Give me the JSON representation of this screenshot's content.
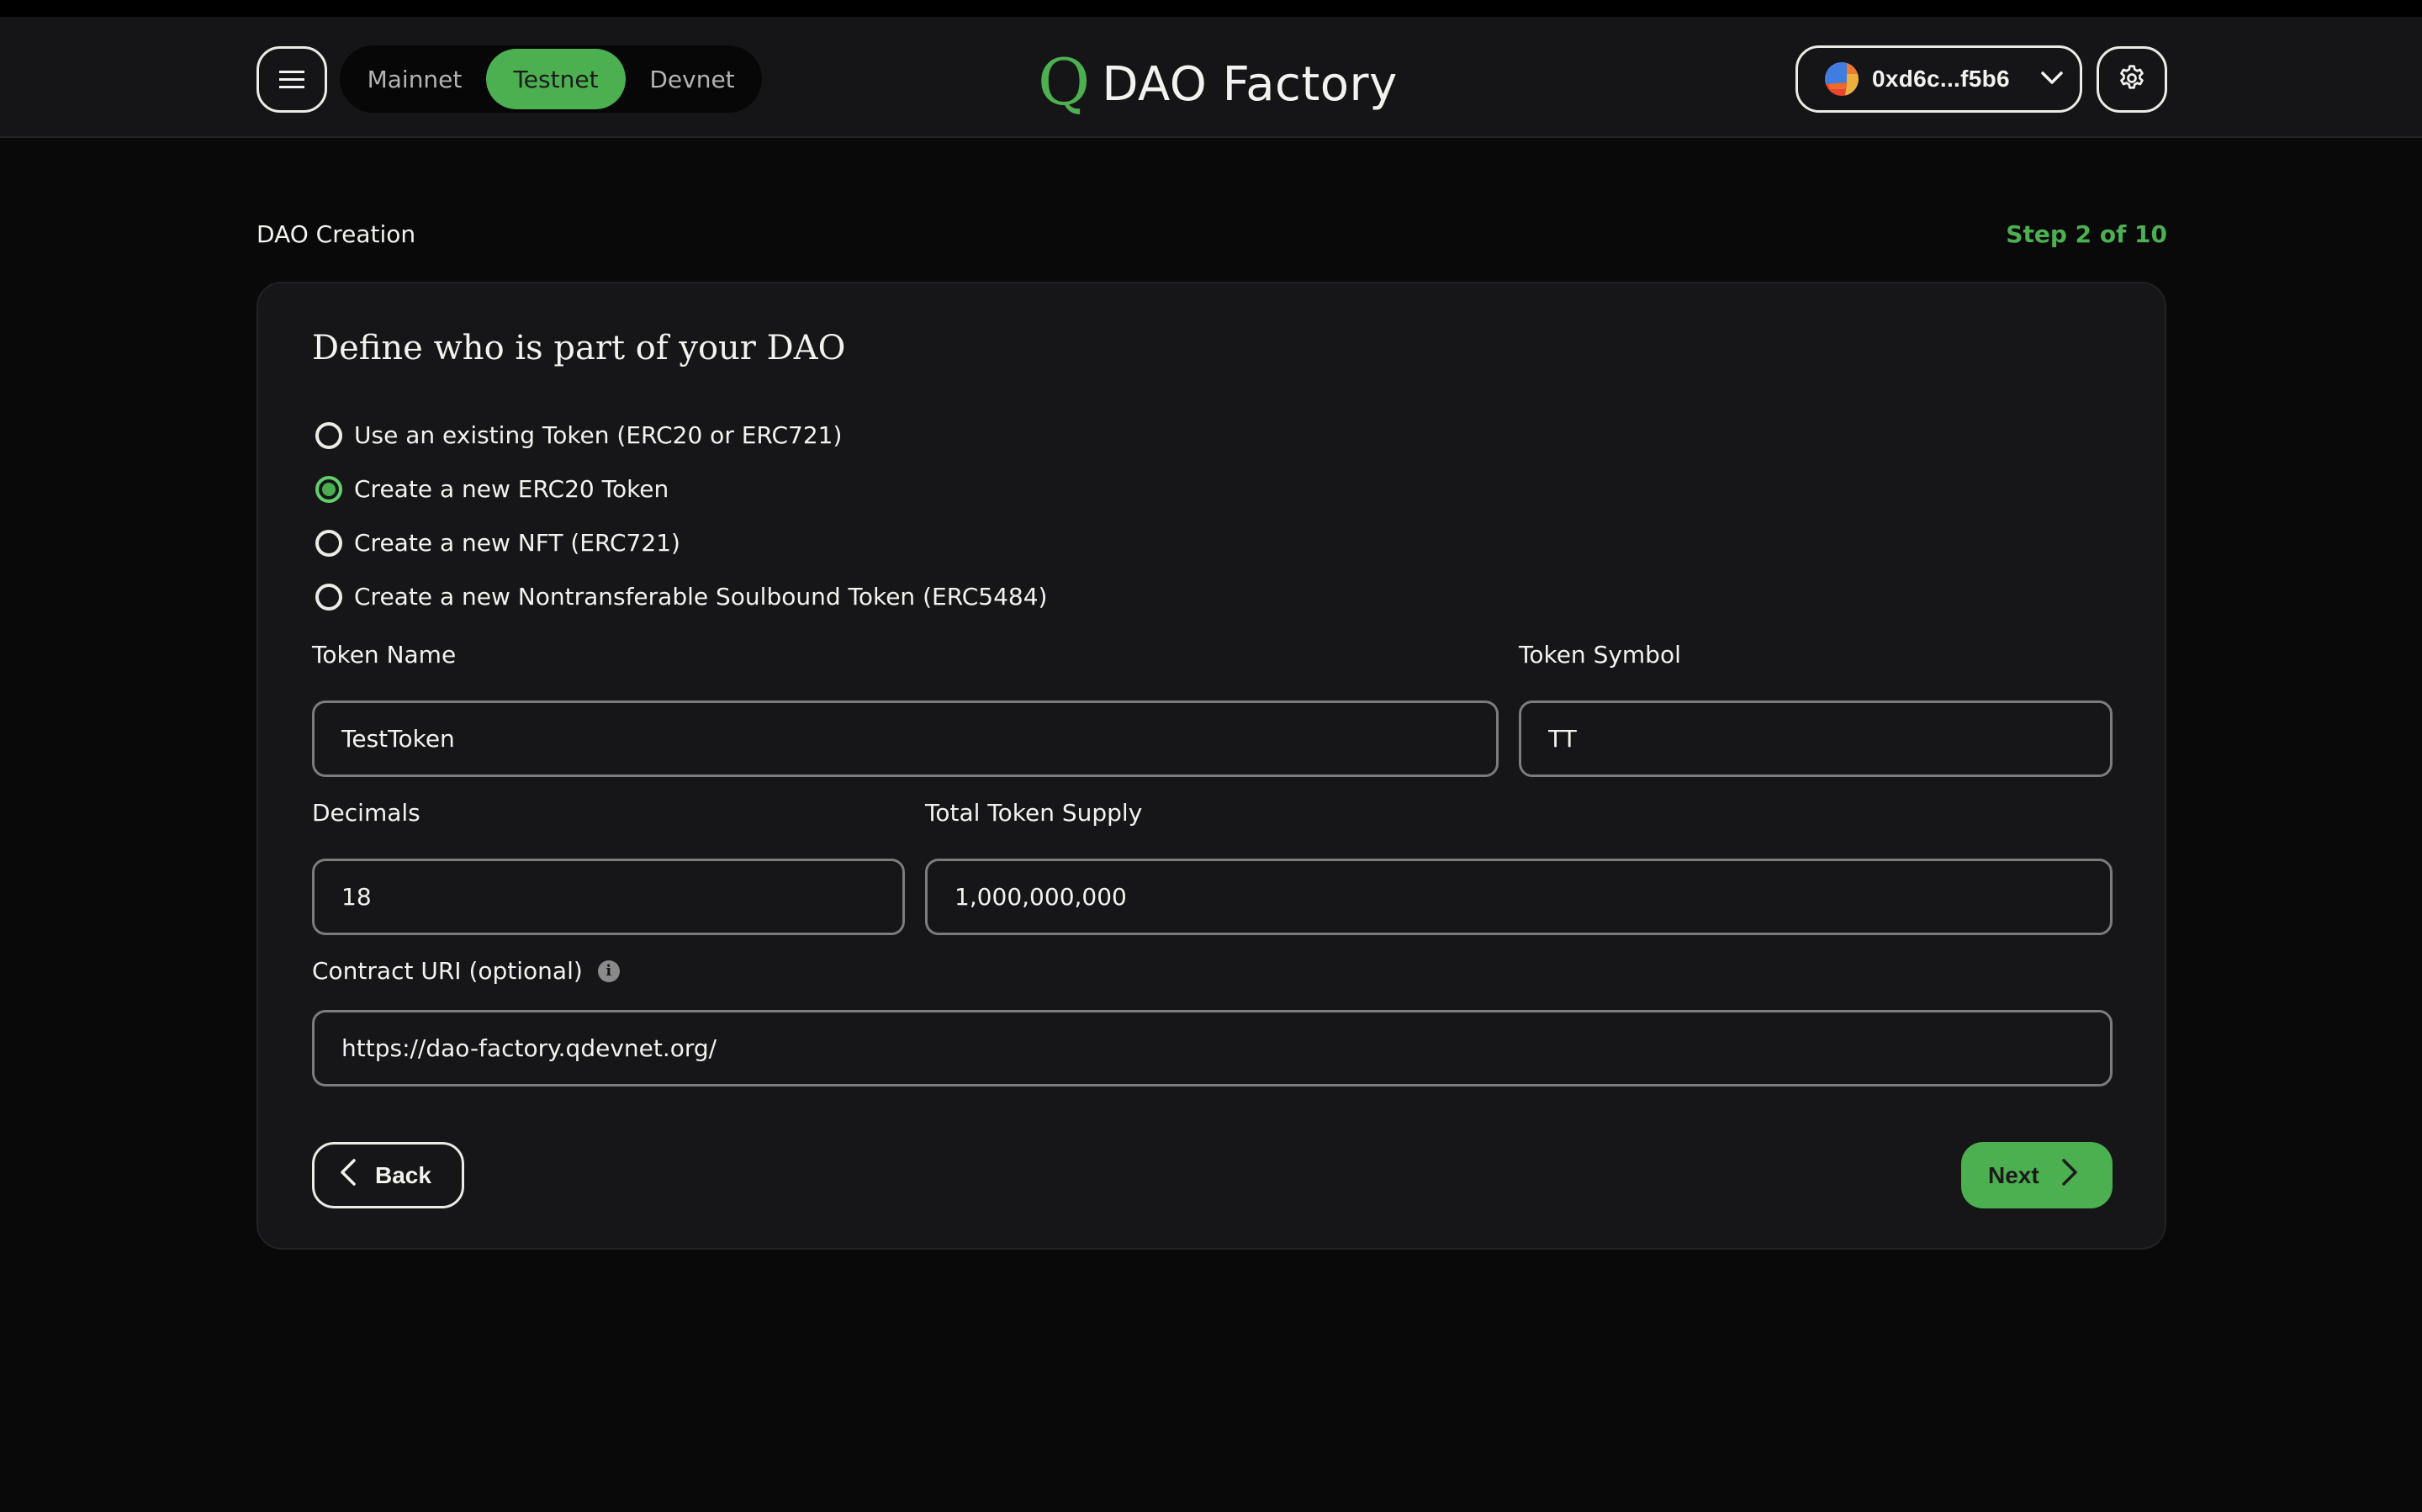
{
  "header": {
    "menu_icon": "hamburger-menu-icon",
    "networks": [
      {
        "label": "Mainnet",
        "active": false
      },
      {
        "label": "Testnet",
        "active": true
      },
      {
        "label": "Devnet",
        "active": false
      }
    ],
    "logo_mark": "Q",
    "app_title": "DAO Factory",
    "wallet": {
      "avatar_icon": "wallet-avatar-icon",
      "address": "0xd6c...f5b6",
      "chevron_icon": "chevron-down-icon"
    },
    "settings_icon": "gear-icon"
  },
  "colors": {
    "accent": "#4caf50",
    "page_bg": "#09090a",
    "card_bg": "#161618",
    "header_bg": "#151517",
    "input_border": "#7c7c7c"
  },
  "page": {
    "section_label": "DAO Creation",
    "step_label": "Step 2 of 10"
  },
  "form": {
    "title": "Define who is part of your DAO",
    "options": [
      {
        "label": "Use an existing Token (ERC20 or ERC721)",
        "checked": false
      },
      {
        "label": "Create a new ERC20 Token",
        "checked": true
      },
      {
        "label": "Create a new NFT (ERC721)",
        "checked": false
      },
      {
        "label": "Create a new Nontransferable Soulbound Token (ERC5484)",
        "checked": false
      }
    ],
    "fields": {
      "token_name": {
        "label": "Token Name",
        "value": "TestToken"
      },
      "token_symbol": {
        "label": "Token Symbol",
        "value": "TT"
      },
      "decimals": {
        "label": "Decimals",
        "value": "18"
      },
      "total_supply": {
        "label": "Total Token Supply",
        "value": "1,000,000,000"
      },
      "contract_uri": {
        "label": "Contract URI (optional)",
        "value": "https://dao-factory.qdevnet.org/",
        "info_icon": "i"
      }
    },
    "back_label": "Back",
    "next_label": "Next"
  }
}
